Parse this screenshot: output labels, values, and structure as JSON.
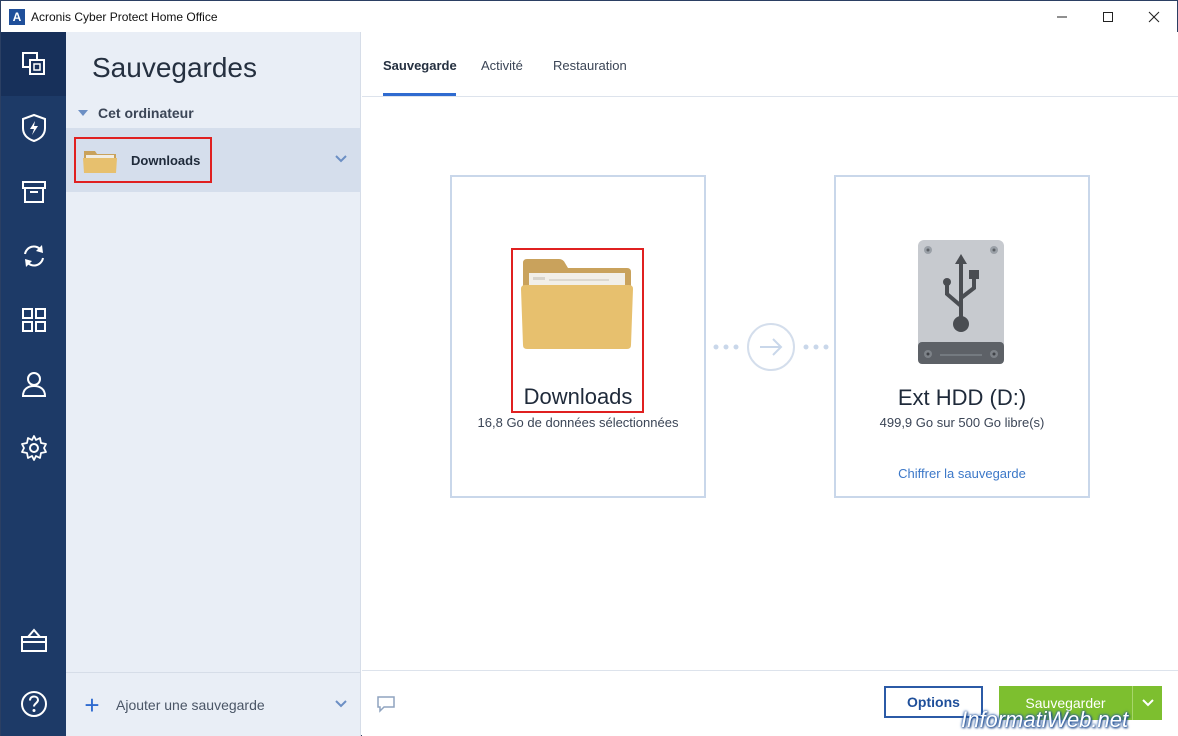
{
  "window": {
    "title": "Acronis Cyber Protect Home Office",
    "logo_letter": "A"
  },
  "nav": {
    "items": [
      {
        "icon": "backup-copy-icon"
      },
      {
        "icon": "shield-icon"
      },
      {
        "icon": "archive-icon"
      },
      {
        "icon": "sync-icon"
      },
      {
        "icon": "tools-grid-icon"
      },
      {
        "icon": "account-icon"
      },
      {
        "icon": "settings-gear-icon"
      },
      {
        "icon": "store-bag-icon"
      },
      {
        "icon": "help-icon"
      }
    ]
  },
  "sidebar": {
    "title": "Sauvegardes",
    "section": "Cet ordinateur",
    "item": {
      "label": "Downloads"
    },
    "add_label": "Ajouter une sauvegarde"
  },
  "tabs": [
    {
      "label": "Sauvegarde"
    },
    {
      "label": "Activité"
    },
    {
      "label": "Restauration"
    }
  ],
  "source": {
    "title": "Downloads",
    "subtitle": "16,8 Go de données sélectionnées"
  },
  "destination": {
    "title": "Ext HDD (D:)",
    "subtitle": "499,9 Go sur 500 Go libre(s)",
    "link": "Chiffrer la sauvegarde"
  },
  "footer": {
    "options_label": "Options",
    "save_label": "Sauvegarder"
  },
  "watermark": "InformatiWeb.net",
  "colors": {
    "nav_bg": "#1d3a67",
    "accent": "#2f6bd0",
    "save_green": "#7dbf2f",
    "highlight_red": "#e02020"
  }
}
